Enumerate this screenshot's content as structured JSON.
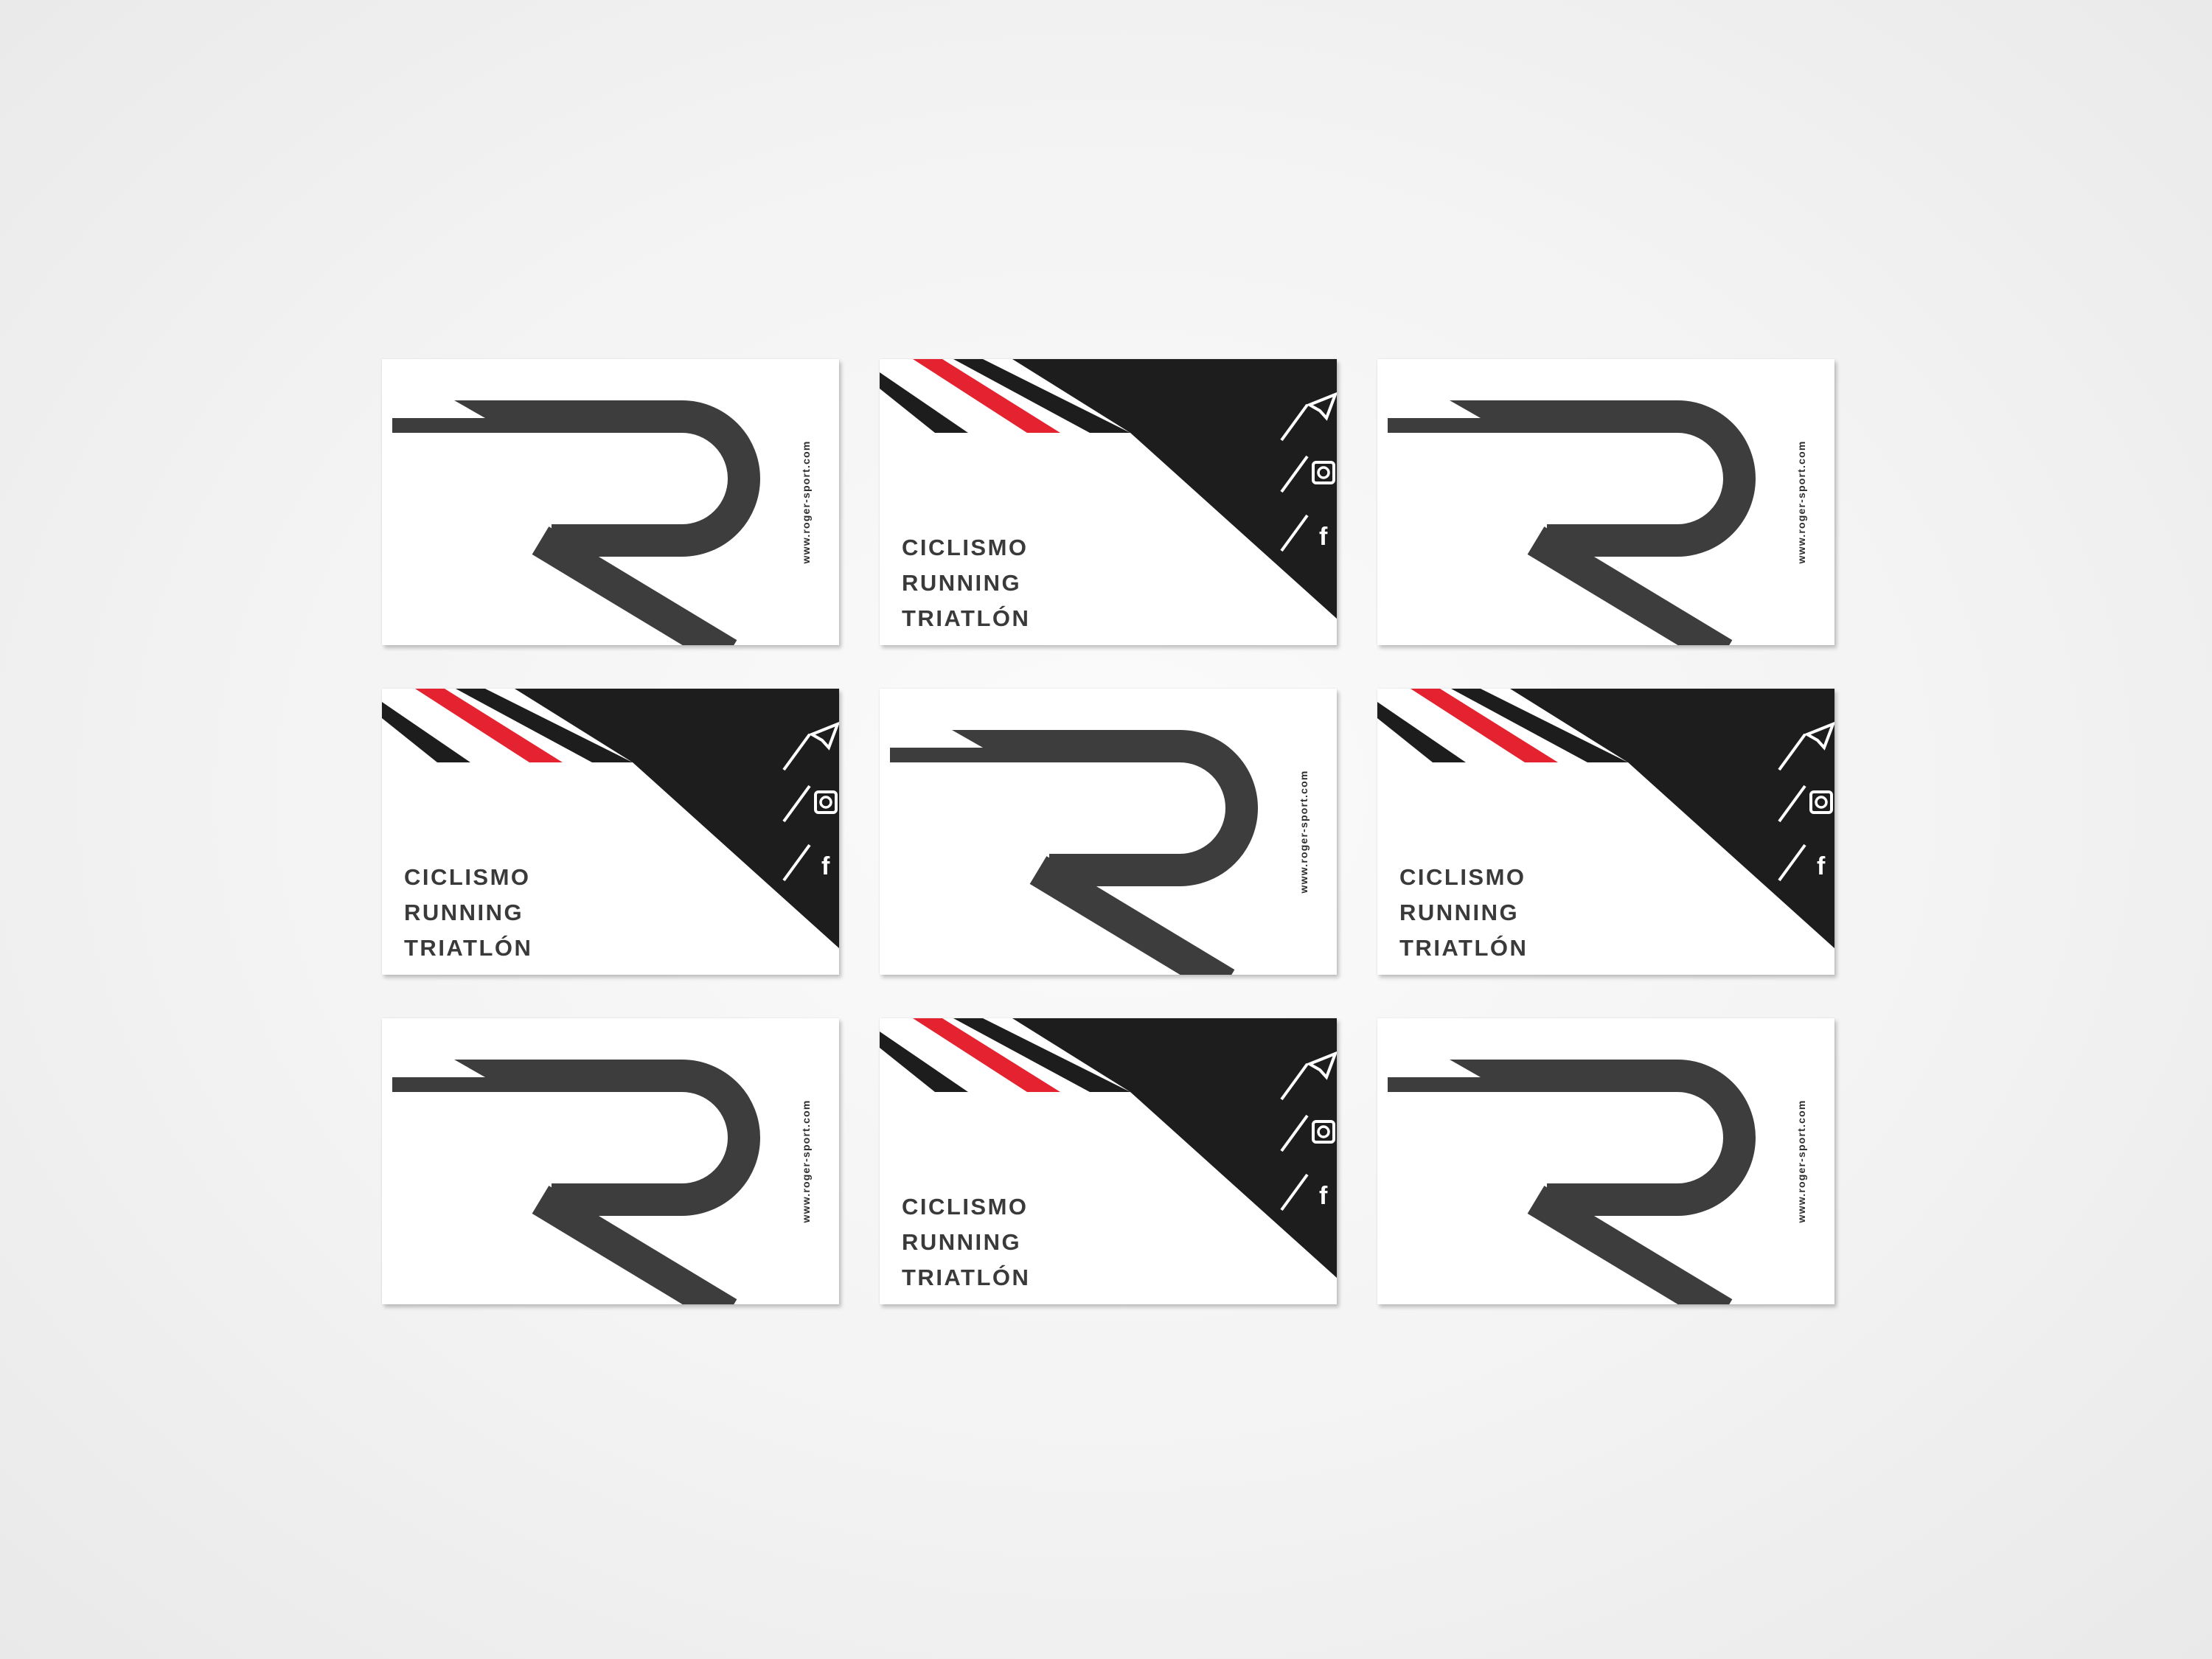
{
  "background": "#f2f2f2",
  "colors": {
    "ink": "#1d1d1d",
    "logo": "#3d3d3d",
    "accent": "#e52330",
    "text": "#3a3a3a",
    "paper": "#ffffff"
  },
  "logo_icon": "r-monogram-icon",
  "card_back": {
    "url": "www.roger-sport.com"
  },
  "card_front": {
    "sports": [
      "CICLISMO",
      "RUNNING",
      "TRIATLÓN"
    ],
    "social_icons": [
      "paper-plane-icon",
      "instagram-icon",
      "facebook-icon"
    ]
  },
  "grid": [
    [
      "back",
      "front",
      "back"
    ],
    [
      "front",
      "back",
      "front"
    ],
    [
      "back",
      "front",
      "back"
    ]
  ]
}
